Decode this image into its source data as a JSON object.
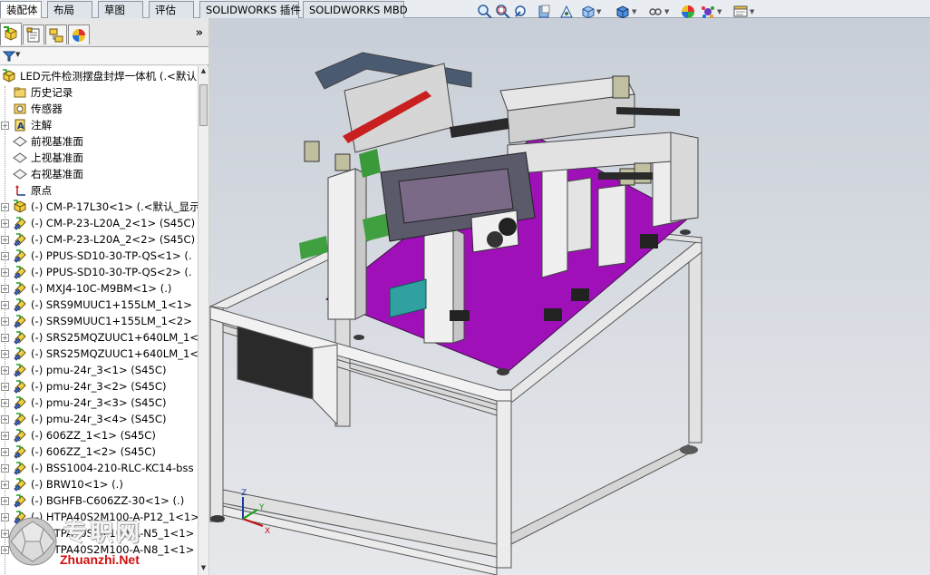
{
  "command_tabs": [
    {
      "label": "装配体",
      "active": true
    },
    {
      "label": "布局",
      "active": false
    },
    {
      "label": "草图",
      "active": false
    },
    {
      "label": "评估",
      "active": false
    },
    {
      "label": "SOLIDWORKS 插件",
      "active": false
    },
    {
      "label": "SOLIDWORKS MBD",
      "active": false
    }
  ],
  "heads_up_toolbar": [
    "zoom-to-fit-icon",
    "zoom-to-area-icon",
    "previous-view-icon",
    "section-view-icon",
    "dynamic-annotation-icon",
    "view-orientation-icon",
    "display-style-icon",
    "hide-show-icon",
    "edit-appearance-icon",
    "apply-scene-icon",
    "view-settings-icon"
  ],
  "panel_tabs": [
    "featuremanager-tree-icon",
    "propertymanager-icon",
    "configurationmanager-icon",
    "displaymanager-icon"
  ],
  "panel_more": "»",
  "tree": {
    "root": "LED元件检测摆盘封焊一体机  (.<默认",
    "items": [
      {
        "label": "历史记录",
        "icon": "history-folder-icon",
        "expandable": false
      },
      {
        "label": "传感器",
        "icon": "sensor-icon",
        "expandable": false
      },
      {
        "label": "注解",
        "icon": "annotation-icon",
        "expandable": true
      },
      {
        "label": "前视基准面",
        "icon": "plane-icon",
        "expandable": false
      },
      {
        "label": "上视基准面",
        "icon": "plane-icon",
        "expandable": false
      },
      {
        "label": "右视基准面",
        "icon": "plane-icon",
        "expandable": false
      },
      {
        "label": "原点",
        "icon": "origin-icon",
        "expandable": false
      },
      {
        "label": "(-) CM-P-17L30<1> (.<默认_显示",
        "icon": "assembly-icon",
        "expandable": true
      },
      {
        "label": "(-) CM-P-23-L20A_2<1> (S45C)",
        "icon": "part-icon",
        "expandable": true
      },
      {
        "label": "(-) CM-P-23-L20A_2<2> (S45C)",
        "icon": "part-icon",
        "expandable": true
      },
      {
        "label": "(-) PPUS-SD10-30-TP-QS<1> (.",
        "icon": "part-icon",
        "expandable": true
      },
      {
        "label": "(-) PPUS-SD10-30-TP-QS<2> (.",
        "icon": "part-icon",
        "expandable": true
      },
      {
        "label": "(-) MXJ4-10C-M9BM<1> (.)",
        "icon": "part-icon",
        "expandable": true
      },
      {
        "label": "(-) SRS9MUUC1+155LM_1<1>",
        "icon": "part-icon",
        "expandable": true
      },
      {
        "label": "(-) SRS9MUUC1+155LM_1<2>",
        "icon": "part-icon",
        "expandable": true
      },
      {
        "label": "(-) SRS25MQZUUC1+640LM_1<",
        "icon": "part-icon",
        "expandable": true
      },
      {
        "label": "(-) SRS25MQZUUC1+640LM_1<",
        "icon": "part-icon",
        "expandable": true
      },
      {
        "label": "(-) pmu-24r_3<1> (S45C)",
        "icon": "part-icon",
        "expandable": true
      },
      {
        "label": "(-) pmu-24r_3<2> (S45C)",
        "icon": "part-icon",
        "expandable": true
      },
      {
        "label": "(-) pmu-24r_3<3> (S45C)",
        "icon": "part-icon",
        "expandable": true
      },
      {
        "label": "(-) pmu-24r_3<4> (S45C)",
        "icon": "part-icon",
        "expandable": true
      },
      {
        "label": "(-) 606ZZ_1<1> (S45C)",
        "icon": "part-icon",
        "expandable": true
      },
      {
        "label": "(-) 606ZZ_1<2> (S45C)",
        "icon": "part-icon",
        "expandable": true
      },
      {
        "label": "(-) BSS1004-210-RLC-KC14-bss",
        "icon": "part-icon",
        "expandable": true
      },
      {
        "label": "(-) BRW10<1> (.)",
        "icon": "part-icon",
        "expandable": true
      },
      {
        "label": "(-) BGHFB-C606ZZ-30<1> (.)",
        "icon": "part-icon",
        "expandable": true
      },
      {
        "label": "(-) HTPA40S2M100-A-P12_1<1>",
        "icon": "part-icon",
        "expandable": true
      },
      {
        "label": "(-) HTPA40S2M100-A-N5_1<1>",
        "icon": "part-icon",
        "expandable": true
      },
      {
        "label": "(-) HTPA40S2M100-A-N8_1<1>",
        "icon": "part-icon",
        "expandable": true
      }
    ]
  },
  "triad": {
    "x": "X",
    "y": "Y",
    "z": "Z"
  },
  "watermark": {
    "cn": "专职网",
    "en": "Zhuanzhi.Net"
  },
  "colors": {
    "accent_magenta": "#a010b8",
    "frame_white": "#eeeeee",
    "viewport_top": "#c9cfd8"
  }
}
